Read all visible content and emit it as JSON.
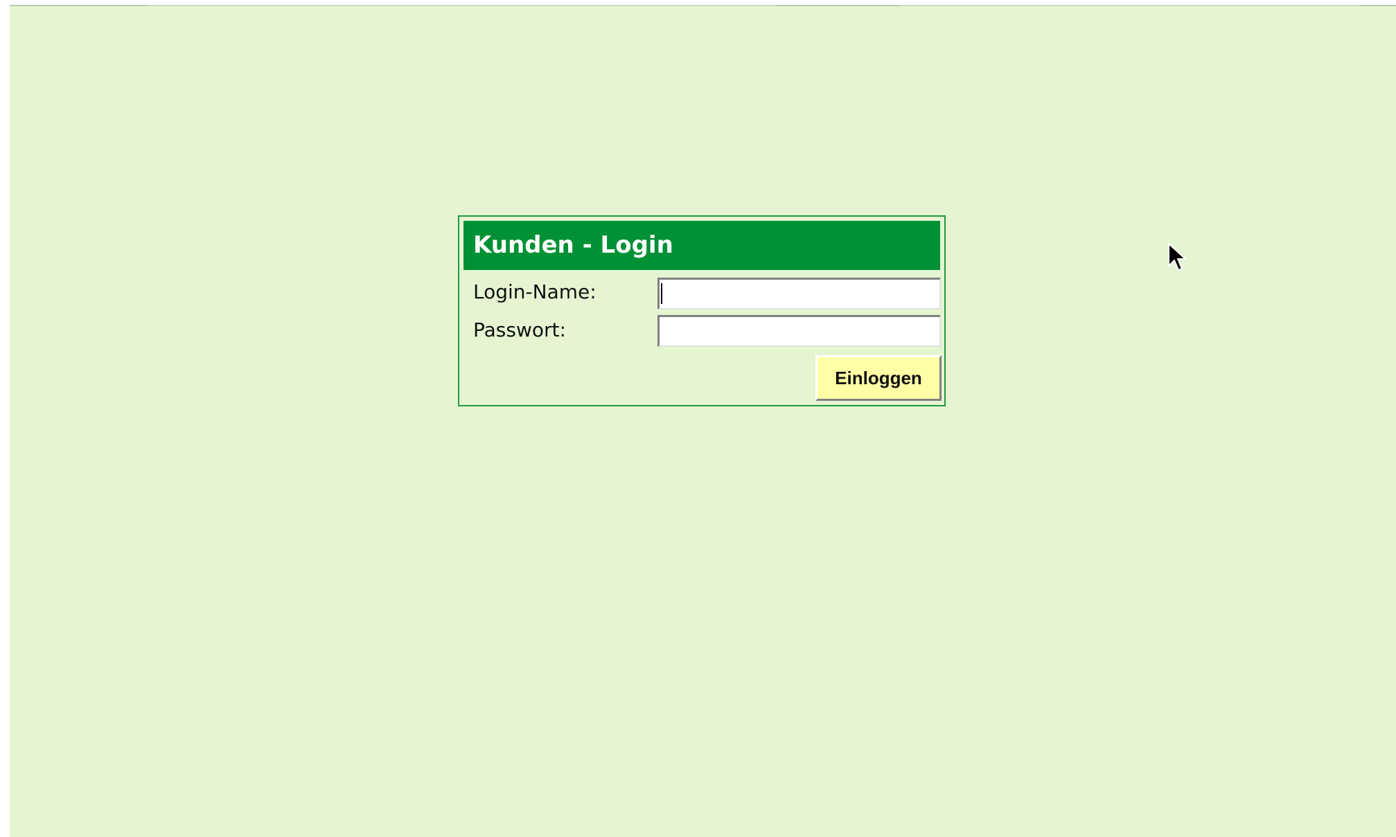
{
  "login": {
    "title": "Kunden - Login",
    "login_name_label": "Login-Name:",
    "login_name_value": "",
    "password_label": "Passwort:",
    "password_value": "",
    "submit_label": "Einloggen"
  },
  "icons": {
    "cursor": "mouse-pointer-icon"
  },
  "colors": {
    "page_background": "#e5f5d2",
    "header_background": "#009135",
    "border": "#1f9a3c",
    "button_background": "#ffffa6"
  }
}
